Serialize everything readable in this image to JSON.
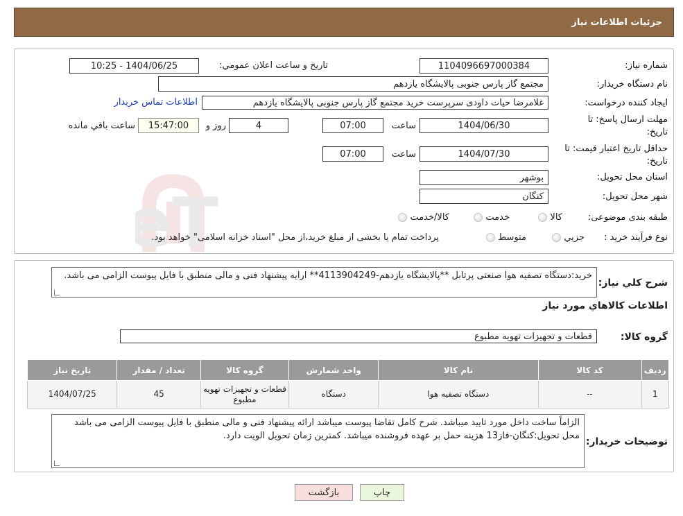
{
  "header": {
    "title": "جزئیات اطلاعات نیاز"
  },
  "form": {
    "need_number": {
      "label": "شماره نیاز:",
      "value": "1104096697000384"
    },
    "announce_datetime": {
      "label": "تاریخ و ساعت اعلان عمومي:",
      "value": "1404/06/25 - 10:25"
    },
    "buyer_org": {
      "label": "نام دستگاه خریدار:",
      "value": "مجتمع گاز پارس جنوبی  پالایشگاه یازدهم"
    },
    "requester": {
      "label": "ایجاد کننده درخواست:",
      "value": "غلامرضا حیات داودی سرپرست خرید مجتمع گاز پارس جنوبی  پالایشگاه یازدهم",
      "contact_link": "اطلاعات تماس خریدار"
    },
    "deadline": {
      "label_line1": "مهلت ارسال پاسخ: تا",
      "label_line2": "تاریخ:",
      "date": "1404/06/30",
      "time_label": "ساعت",
      "time": "07:00",
      "days": "4",
      "days_label": "روز و",
      "remaining": "15:47:00",
      "remaining_label": "ساعت باقي مانده"
    },
    "price_validity": {
      "label_line1": "حداقل تاریخ اعتبار قیمت: تا",
      "label_line2": "تاریخ:",
      "date": "1404/07/30",
      "time_label": "ساعت",
      "time": "07:00"
    },
    "province": {
      "label": "استان محل تحویل:",
      "value": "بوشهر"
    },
    "city": {
      "label": "شهر محل تحویل:",
      "value": "کنگان"
    },
    "category": {
      "label": "طبقه بندی موضوعی:",
      "options": [
        "کالا",
        "خدمت",
        "کالا/خدمت"
      ]
    },
    "process": {
      "label": "نوع فرآیند خرید :",
      "options": [
        "جزیي",
        "متوسط"
      ],
      "note": "پرداخت تمام یا بخشی از مبلغ خرید،از محل \"اسناد خزانه اسلامی\" خواهد بود."
    }
  },
  "description": {
    "label": "شرح کلي نیاز:",
    "text": "خرید:دستگاه تصفیه هوا صنعتی پرتابل **پالایشگاه یازدهم-4113904249** ارایه پیشنهاد فنی و مالی منطبق با فایل پیوست الزامی می باشد."
  },
  "goods_info": {
    "title": "اطلاعات کالاهاي مورد نیاز"
  },
  "goods_group": {
    "label": "گروه کالا:",
    "value": "قطعات و تجهیزات تهویه مطبوع"
  },
  "table": {
    "headers": [
      "ردیف",
      "کد کالا",
      "نام کالا",
      "واحد شمارش",
      "گروه کالا",
      "تعداد / مقدار",
      "تاریخ نیاز"
    ],
    "rows": [
      {
        "row": "1",
        "code": "--",
        "name": "دستگاه تصفیه هوا",
        "unit": "دستگاه",
        "group": "قطعات و تجهیزات تهویه مطبوع",
        "qty": "45",
        "date": "1404/07/25"
      }
    ]
  },
  "buyer_notes": {
    "label": "توضیحات خریدار:",
    "text": "الزاماً ساخت داخل مورد تایید میباشد. شرح کامل تقاضا پیوست میباشد ارائه پیشنهاد فنی و مالی منطبق با فایل پیوست الزامی می باشد محل تحویل:کنگان-فاز13 هزینه حمل بر عهده فروشنده میباشد. کمترین زمان تحویل الویت دارد."
  },
  "buttons": {
    "print": "چاپ",
    "back": "بازگشت"
  },
  "watermark": "AriaTender.neT",
  "colors": {
    "header_bg": "#8f6a45",
    "table_header_bg": "#9a9a9a",
    "link": "#1a3fb5",
    "print_btn": "#eaf7dc",
    "back_btn": "#f9dede"
  }
}
